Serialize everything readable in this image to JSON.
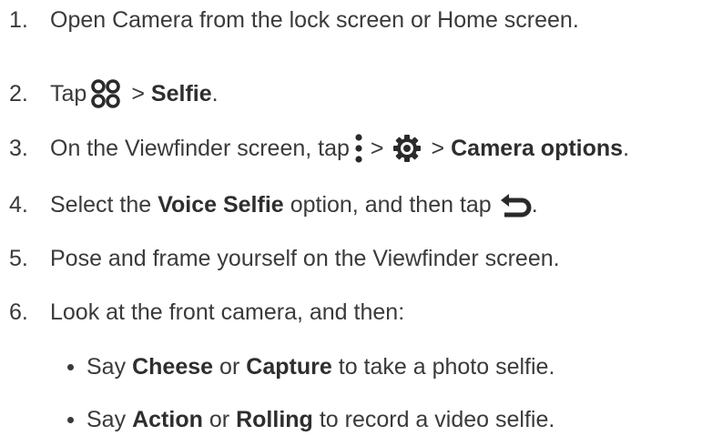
{
  "steps": [
    {
      "num": "1.",
      "text": "Open Camera from the lock screen or Home screen."
    },
    {
      "num": "2.",
      "pre": "Tap",
      "icon": "modes-icon",
      "mid": ">",
      "bold": "Selfie",
      "post": "."
    },
    {
      "num": "3.",
      "pre": "On the Viewfinder screen, tap",
      "icon1": "more-vertical-icon",
      "mid1": ">",
      "icon2": "gear-icon",
      "mid2": ">",
      "bold": "Camera options",
      "post": "."
    },
    {
      "num": "4.",
      "pre": "Select the",
      "bold": "Voice Selfie",
      "mid": "option, and then tap",
      "icon": "back-arrow-icon",
      "post": "."
    },
    {
      "num": "5.",
      "text": "Pose and frame yourself on the Viewfinder screen."
    },
    {
      "num": "6.",
      "text": "Look at the front camera, and then:"
    }
  ],
  "bullets": [
    {
      "pre": "Say",
      "bold1": "Cheese",
      "mid": "or",
      "bold2": "Capture",
      "post": "to take a photo selfie."
    },
    {
      "pre": "Say",
      "bold1": "Action",
      "mid": "or",
      "bold2": "Rolling",
      "post": "to record a video selfie."
    }
  ]
}
